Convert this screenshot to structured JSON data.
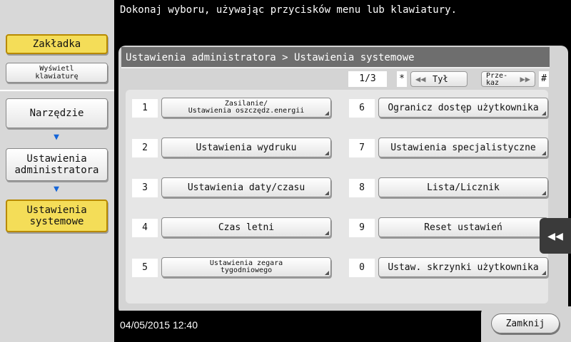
{
  "topbar": {
    "message": "Dokonaj wyboru, używając przycisków menu lub klawiatury."
  },
  "sidebar": {
    "bookmark_label": "Zakładka",
    "keypad_label_line1": "Wyświetl",
    "keypad_label_line2": "klawiaturę",
    "breadcrumb": [
      {
        "label": "Narzędzie"
      },
      {
        "label_line1": "Ustawienia",
        "label_line2": "administratora"
      },
      {
        "label_line1": "Ustawienia",
        "label_line2": "systemowe"
      }
    ],
    "arrow_icon": "arrow-down-icon"
  },
  "header": {
    "title": "Ustawienia administratora > Ustawienia systemowe"
  },
  "pager": {
    "page": "1/3",
    "star_label": "*",
    "back_label": "Tył",
    "forward_label_line1": "Prze-",
    "forward_label_line2": "kaz",
    "hash_label": "#"
  },
  "menu": {
    "left": [
      {
        "num": "1",
        "label_line1": "Zasilanie/",
        "label_line2": "Ustawienia oszczędz.energii"
      },
      {
        "num": "2",
        "label": "Ustawienia wydruku"
      },
      {
        "num": "3",
        "label": "Ustawienia daty/czasu"
      },
      {
        "num": "4",
        "label": "Czas letni"
      },
      {
        "num": "5",
        "label_line1": "Ustawienia zegara",
        "label_line2": "tygodniowego"
      }
    ],
    "right": [
      {
        "num": "6",
        "label": "Ogranicz dostęp użytkownika"
      },
      {
        "num": "7",
        "label": "Ustawienia specjalistyczne"
      },
      {
        "num": "8",
        "label": "Lista/Licznik"
      },
      {
        "num": "9",
        "label": "Reset ustawień"
      },
      {
        "num": "0",
        "label": "Ustaw. skrzynki użytkownika"
      }
    ]
  },
  "footer": {
    "datetime": "04/05/2015  12:40",
    "close_label": "Zamknij"
  },
  "side_tab": {
    "icon": "rewind-icon"
  }
}
